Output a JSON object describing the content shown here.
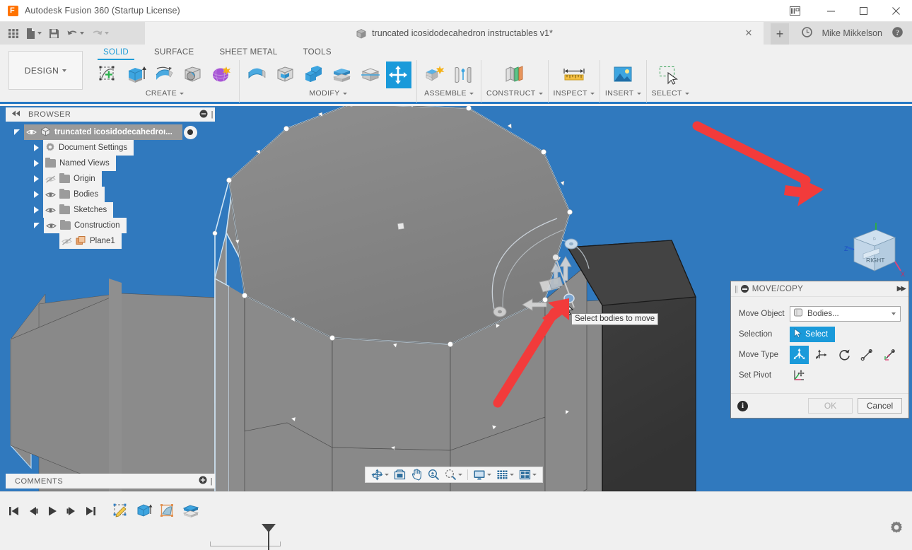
{
  "titlebar": {
    "app_name": "Autodesk Fusion 360 (Startup License)",
    "logo_letter": "F",
    "buttons": [
      {
        "name": "layout-panels-icon",
        "label": ""
      },
      {
        "name": "minimize-button",
        "label": "—"
      },
      {
        "name": "maximize-button",
        "label": "□"
      },
      {
        "name": "close-button",
        "label": "✕"
      }
    ]
  },
  "quick_access": {
    "items": [
      {
        "name": "app-grid-button",
        "label": ""
      },
      {
        "name": "new-file-button",
        "label": ""
      },
      {
        "name": "save-button",
        "label": ""
      },
      {
        "name": "undo-button",
        "label": ""
      },
      {
        "name": "redo-button",
        "label": ""
      }
    ]
  },
  "document_tab": {
    "title": "truncated icosidodecahedron instructables v1*",
    "close_label": "✕",
    "new_tab_label": "+"
  },
  "account": {
    "user_name": "Mike Mikkelson",
    "recent_icon": "clock-icon",
    "help_icon": "help-icon"
  },
  "workspace": {
    "label": "DESIGN",
    "caret": "▾"
  },
  "ribbon_tabs": [
    {
      "label": "SOLID",
      "active": true
    },
    {
      "label": "SURFACE",
      "active": false
    },
    {
      "label": "SHEET METAL",
      "active": false
    },
    {
      "label": "TOOLS",
      "active": false
    }
  ],
  "ribbon_panels": [
    {
      "label": "CREATE",
      "has_caret": true,
      "tools": [
        {
          "name": "create-sketch-tool",
          "icon": "sketch-plus-icon",
          "active": false
        },
        {
          "name": "extrude-tool",
          "icon": "extrude-icon",
          "active": false
        },
        {
          "name": "revolve-tool",
          "icon": "revolve-icon",
          "active": false
        },
        {
          "name": "sweep-tool",
          "icon": "hole-icon",
          "active": false
        },
        {
          "name": "form-tool",
          "icon": "form-purple-icon",
          "active": false
        }
      ]
    },
    {
      "label": "MODIFY",
      "has_caret": true,
      "tools": [
        {
          "name": "press-pull-tool",
          "icon": "press-pull-icon",
          "active": false
        },
        {
          "name": "fillet-tool",
          "icon": "fillet-icon",
          "active": false
        },
        {
          "name": "shell-tool",
          "icon": "shell-icon",
          "active": false
        },
        {
          "name": "combine-tool",
          "icon": "combine-icon",
          "active": false
        },
        {
          "name": "split-body-tool",
          "icon": "split-body-icon",
          "active": false
        },
        {
          "name": "move-copy-tool",
          "icon": "move-arrows-icon",
          "active": true
        }
      ]
    },
    {
      "label": "ASSEMBLE",
      "has_caret": true,
      "tools": [
        {
          "name": "new-component-tool",
          "icon": "new-component-icon",
          "active": false
        },
        {
          "name": "joint-tool",
          "icon": "joint-icon",
          "active": false
        }
      ]
    },
    {
      "label": "CONSTRUCT",
      "has_caret": true,
      "tools": [
        {
          "name": "offset-plane-tool",
          "icon": "offset-plane-icon",
          "active": false
        }
      ]
    },
    {
      "label": "INSPECT",
      "has_caret": true,
      "tools": [
        {
          "name": "measure-tool",
          "icon": "ruler-icon",
          "active": false
        }
      ]
    },
    {
      "label": "INSERT",
      "has_caret": true,
      "tools": [
        {
          "name": "insert-image-tool",
          "icon": "image-icon",
          "active": false
        }
      ]
    },
    {
      "label": "SELECT",
      "has_caret": true,
      "tools": [
        {
          "name": "select-tool",
          "icon": "marquee-cursor-icon",
          "active": false
        }
      ]
    }
  ],
  "browser": {
    "header": "BROWSER",
    "collapse_icon": "collapse-left-icon",
    "minimize_icon": "minimize-circle-icon",
    "grip_icon": "grip-icon",
    "root": {
      "label": "truncated icosidodecahedroı...",
      "selected": true,
      "indent": 0,
      "expanded": true,
      "visible": true,
      "icon": "component-cube-icon"
    },
    "items": [
      {
        "label": "Document Settings",
        "icon": "gear-icon",
        "indent": 1,
        "expanded": false,
        "eye": "none"
      },
      {
        "label": "Named Views",
        "icon": "folder-icon",
        "indent": 1,
        "expanded": false,
        "eye": "none"
      },
      {
        "label": "Origin",
        "icon": "folder-icon",
        "indent": 1,
        "expanded": false,
        "eye": "hidden"
      },
      {
        "label": "Bodies",
        "icon": "folder-icon",
        "indent": 1,
        "expanded": false,
        "eye": "visible"
      },
      {
        "label": "Sketches",
        "icon": "folder-icon",
        "indent": 1,
        "expanded": false,
        "eye": "visible"
      },
      {
        "label": "Construction",
        "icon": "folder-icon",
        "indent": 1,
        "expanded": true,
        "eye": "visible"
      },
      {
        "label": "Plane1",
        "icon": "plane-icon",
        "indent": 2,
        "expanded": null,
        "eye": "hidden"
      }
    ]
  },
  "comments": {
    "label": "COMMENTS",
    "add_icon": "add-comment-icon",
    "grip_icon": "grip-icon"
  },
  "canvas": {
    "background_color": "#3079be",
    "tooltip_text": "Select bodies to move",
    "body_fill": "#878787",
    "body_dark_fill": "#3b3b3b",
    "highlight_edge_color": "#b9d8ef",
    "viewcube": {
      "face_label": "RIGHT",
      "axis_z": "Z",
      "axis_x": "X"
    },
    "annotation_arrow_color": "#f23b3b"
  },
  "navbar": {
    "items": [
      {
        "name": "orbit-button",
        "icon": "orbit-icon",
        "caret": true
      },
      {
        "name": "look-at-button",
        "icon": "look-at-icon",
        "caret": false
      },
      {
        "name": "pan-button",
        "icon": "hand-icon",
        "caret": false
      },
      {
        "name": "zoom-button",
        "icon": "zoom-icon",
        "caret": false
      },
      {
        "name": "fit-button",
        "icon": "zoom-window-icon",
        "caret": true
      },
      {
        "name": "display-settings-button",
        "icon": "monitor-icon",
        "caret": true
      },
      {
        "name": "grid-snaps-button",
        "icon": "grid-icon",
        "caret": true
      },
      {
        "name": "viewports-button",
        "icon": "viewports-icon",
        "caret": true
      }
    ]
  },
  "dialog": {
    "title": "MOVE/COPY",
    "grip_icon": "grip-icon",
    "minimize_icon": "minimize-circle-icon",
    "expand_icon": "expand-right-icon",
    "rows": {
      "move_object_label": "Move Object",
      "move_object_value": "Bodies...",
      "selection_label": "Selection",
      "select_button_label": "Select",
      "move_type_label": "Move Type",
      "set_pivot_label": "Set Pivot"
    },
    "move_types": [
      {
        "name": "move-type-free",
        "icon": "free-move-icon",
        "active": true
      },
      {
        "name": "move-type-translate",
        "icon": "translate-axis-icon",
        "active": false
      },
      {
        "name": "move-type-rotate",
        "icon": "rotate-icon",
        "active": false
      },
      {
        "name": "move-type-point-to-point",
        "icon": "point-to-point-icon",
        "active": false
      },
      {
        "name": "move-type-point-to-position",
        "icon": "point-to-position-icon",
        "active": false
      }
    ],
    "footer": {
      "info_label": "i",
      "ok_label": "OK",
      "ok_disabled": true,
      "cancel_label": "Cancel"
    }
  },
  "timeline": {
    "playback": [
      {
        "name": "jump-to-start-button",
        "icon": "skip-back-icon"
      },
      {
        "name": "step-back-button",
        "icon": "step-back-icon"
      },
      {
        "name": "play-button",
        "icon": "play-icon"
      },
      {
        "name": "step-forward-button",
        "icon": "step-forward-icon"
      },
      {
        "name": "jump-to-end-button",
        "icon": "skip-forward-icon"
      }
    ],
    "features": [
      {
        "name": "timeline-feature-sketch",
        "icon": "sketch-feature-icon"
      },
      {
        "name": "timeline-feature-extrude",
        "icon": "extrude-feature-icon"
      },
      {
        "name": "timeline-feature-plane",
        "icon": "plane-feature-icon"
      },
      {
        "name": "timeline-feature-offset",
        "icon": "offset-feature-icon"
      }
    ],
    "settings_icon": "gear-icon"
  }
}
